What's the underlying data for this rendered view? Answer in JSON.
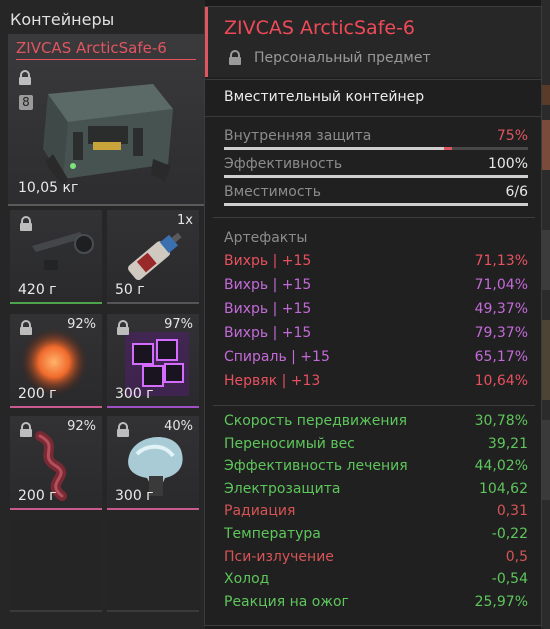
{
  "inventory": {
    "title": "Контейнеры",
    "container": {
      "name": "ZIVCAS ArcticSafe-6",
      "tier": "8",
      "weight": "10,05 кг"
    },
    "slots": [
      {
        "weight": "420 г",
        "icon": "rifle-scope-icon",
        "rarity": "green"
      },
      {
        "weight": "50 г",
        "count": "1x",
        "icon": "medical-syringe-icon",
        "rarity": "none"
      },
      {
        "weight": "200 г",
        "percent": "92%",
        "icon": "orange-orb-artifact-icon",
        "rarity": "pink"
      },
      {
        "weight": "300 г",
        "percent": "97%",
        "icon": "purple-cubes-artifact-icon",
        "rarity": "purple"
      },
      {
        "weight": "200 г",
        "percent": "92%",
        "icon": "red-tendril-artifact-icon",
        "rarity": "pink"
      },
      {
        "weight": "300 г",
        "percent": "40%",
        "icon": "blue-crystal-artifact-icon",
        "rarity": "pink"
      }
    ]
  },
  "tooltip": {
    "name": "ZIVCAS ArcticSafe-6",
    "subtitle": "Персональный предмет",
    "item_type": "Вместительный контейнер",
    "stats": [
      {
        "label": "Внутренняя защита",
        "value": "75%",
        "fill": 0.75,
        "color": "#e15560"
      },
      {
        "label": "Эффективность",
        "value": "100%",
        "fill": 1.0,
        "color": "#e8e8e8"
      },
      {
        "label": "Вместимость",
        "value": "6/6",
        "fill": 1.0,
        "color": "#e8e8e8"
      }
    ],
    "artifacts_title": "Артефакты",
    "artifacts": [
      {
        "label": "Вихрь | +15",
        "value": "71,13%",
        "color": "#e8515e"
      },
      {
        "label": "Вихрь | +15",
        "value": "71,04%",
        "color": "#c46ad8"
      },
      {
        "label": "Вихрь | +15",
        "value": "49,37%",
        "color": "#c46ad8"
      },
      {
        "label": "Вихрь | +15",
        "value": "79,37%",
        "color": "#c46ad8"
      },
      {
        "label": "Спираль | +15",
        "value": "65,17%",
        "color": "#c46ad8"
      },
      {
        "label": "Нервяк | +13",
        "value": "10,64%",
        "color": "#e8515e"
      }
    ],
    "effects": [
      {
        "label": "Скорость передвижения",
        "value": "30,78%",
        "color": "#5ec65b"
      },
      {
        "label": "Переносимый вес",
        "value": "39,21",
        "color": "#5ec65b"
      },
      {
        "label": "Эффективность лечения",
        "value": "44,02%",
        "color": "#5ec65b"
      },
      {
        "label": "Электрозащита",
        "value": "104,62",
        "color": "#5ec65b"
      },
      {
        "label": "Радиация",
        "value": "0,31",
        "color": "#d65454"
      },
      {
        "label": "Температура",
        "value": "-0,22",
        "color": "#5ec65b"
      },
      {
        "label": "Пси-излучение",
        "value": "0,5",
        "color": "#d65454"
      },
      {
        "label": "Холод",
        "value": "-0,54",
        "color": "#5ec65b"
      },
      {
        "label": "Реакция на ожог",
        "value": "25,97%",
        "color": "#5ec65b"
      }
    ]
  }
}
